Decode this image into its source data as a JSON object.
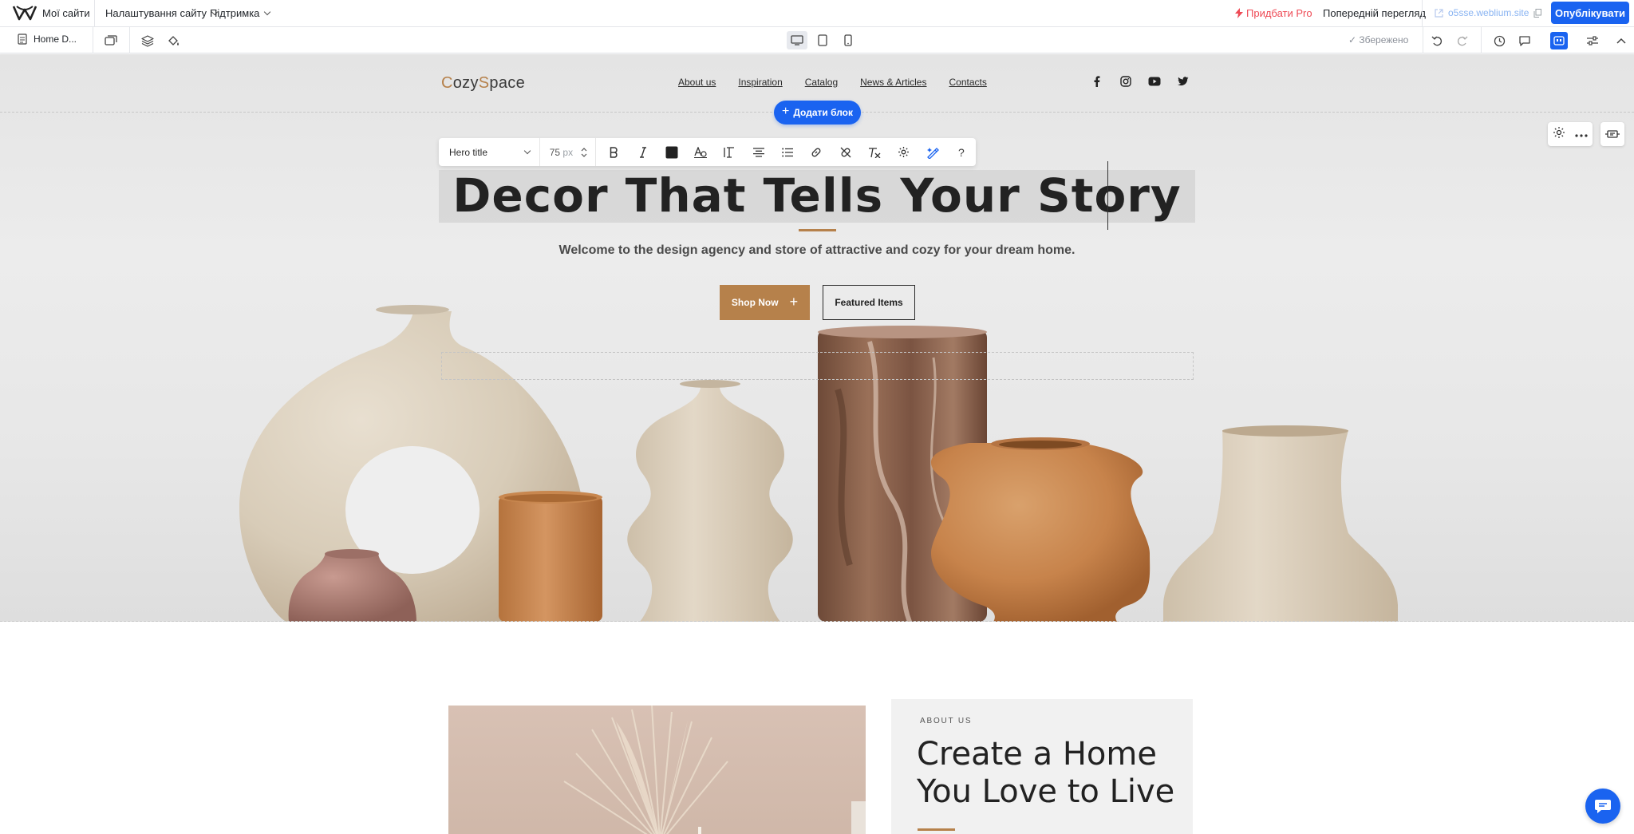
{
  "app": {
    "my_sites": "Мої сайти",
    "menu_site_settings": "Налаштування сайту",
    "menu_support": "Підтримка",
    "add_pro": "Придбати Pro",
    "preview": "Попередній перегляд",
    "domain": "o5sse.weblium.site",
    "publish": "Опублікувати",
    "page_name": "Home D...",
    "saved_status": "✓ Збережено",
    "accent_color": "#1a63f0"
  },
  "site": {
    "brand_first": "C",
    "brand_mid": "ozy",
    "brand_s": "S",
    "brand_last": "pace",
    "nav": [
      "About us",
      "Inspiration",
      "Catalog",
      "News & Articles",
      "Contacts"
    ],
    "socials": [
      "facebook-icon",
      "instagram-icon",
      "youtube-icon",
      "twitter-icon"
    ],
    "add_block": "Додати блок",
    "hero": {
      "title": "Decor That Tells Your Story",
      "subtitle": "Welcome to the design agency and store of attractive and cozy for your dream home.",
      "shop_now": "Shop Now",
      "featured": "Featured Items"
    },
    "about": {
      "label": "ABOUT US",
      "title_line1": "Create a Home",
      "title_line2": "You Love to Live"
    },
    "accent_color": "#b6814b"
  },
  "format_toolbar": {
    "style": "Hero title",
    "size": "75",
    "unit": "px"
  }
}
